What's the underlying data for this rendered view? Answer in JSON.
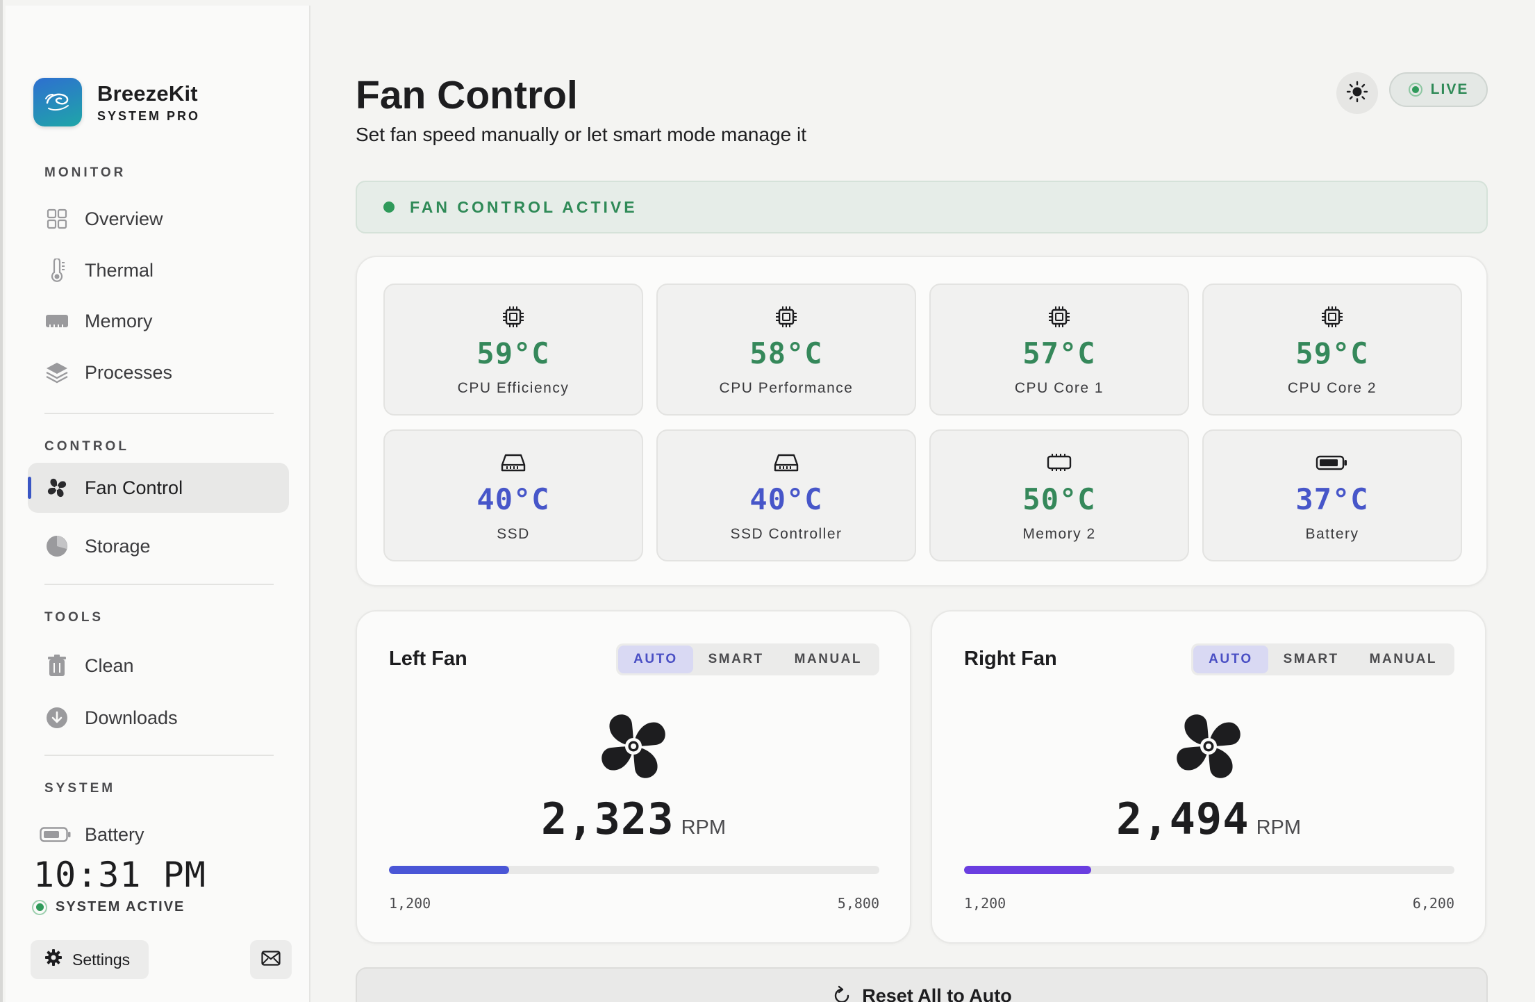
{
  "app": {
    "name": "BreezeKit",
    "subtitle": "SYSTEM PRO"
  },
  "sidebar": {
    "sections": [
      {
        "label": "MONITOR",
        "items": [
          {
            "label": "Overview",
            "icon": "grid-icon"
          },
          {
            "label": "Thermal",
            "icon": "thermometer-icon"
          },
          {
            "label": "Memory",
            "icon": "memory-icon"
          },
          {
            "label": "Processes",
            "icon": "layers-icon"
          }
        ]
      },
      {
        "label": "CONTROL",
        "items": [
          {
            "label": "Fan Control",
            "icon": "fan-icon",
            "active": true
          },
          {
            "label": "Storage",
            "icon": "pie-icon"
          }
        ]
      },
      {
        "label": "TOOLS",
        "items": [
          {
            "label": "Clean",
            "icon": "trash-icon"
          },
          {
            "label": "Downloads",
            "icon": "download-icon"
          }
        ]
      },
      {
        "label": "SYSTEM",
        "items": [
          {
            "label": "Battery",
            "icon": "battery-icon"
          }
        ]
      }
    ],
    "clock": "10:31 PM",
    "system_status": "SYSTEM ACTIVE",
    "settings_label": "Settings"
  },
  "header": {
    "title": "Fan Control",
    "subtitle": "Set fan speed manually or let smart mode manage it",
    "live_label": "LIVE"
  },
  "banner": {
    "text": "FAN CONTROL ACTIVE"
  },
  "sensors": [
    {
      "temp": "59°C",
      "label": "CPU Efficiency",
      "icon": "chip-icon",
      "tone": "green"
    },
    {
      "temp": "58°C",
      "label": "CPU Performance",
      "icon": "chip-icon",
      "tone": "green"
    },
    {
      "temp": "57°C",
      "label": "CPU Core 1",
      "icon": "chip-icon",
      "tone": "green"
    },
    {
      "temp": "59°C",
      "label": "CPU Core 2",
      "icon": "chip-icon",
      "tone": "green"
    },
    {
      "temp": "40°C",
      "label": "SSD",
      "icon": "drive-icon",
      "tone": "blue"
    },
    {
      "temp": "40°C",
      "label": "SSD Controller",
      "icon": "drive-icon",
      "tone": "blue"
    },
    {
      "temp": "50°C",
      "label": "Memory 2",
      "icon": "ram-icon",
      "tone": "green"
    },
    {
      "temp": "37°C",
      "label": "Battery",
      "icon": "battery-icon",
      "tone": "blue"
    }
  ],
  "fans": [
    {
      "title": "Left Fan",
      "modes": [
        "AUTO",
        "SMART",
        "MANUAL"
      ],
      "active_mode": "AUTO",
      "rpm": "2,323",
      "unit": "RPM",
      "min": "1,200",
      "max": "5,800",
      "level": 0.245,
      "fill_color": "#4a56d6"
    },
    {
      "title": "Right Fan",
      "modes": [
        "AUTO",
        "SMART",
        "MANUAL"
      ],
      "active_mode": "AUTO",
      "rpm": "2,494",
      "unit": "RPM",
      "min": "1,200",
      "max": "6,200",
      "level": 0.259,
      "fill_color": "#6a3ee0"
    }
  ],
  "reset_label": "Reset All to Auto",
  "colors": {
    "accent_green": "#2f9a5a",
    "temp_green": "#35885a",
    "temp_blue": "#4756c9",
    "mode_active": "#4a4fc4"
  }
}
